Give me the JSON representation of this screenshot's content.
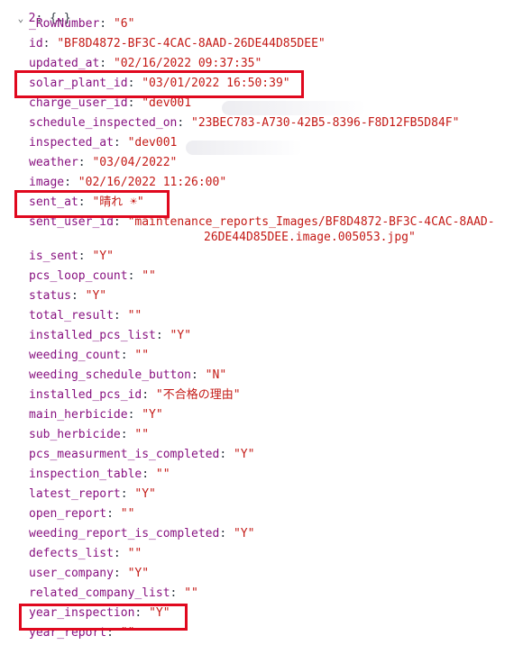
{
  "header": {
    "chevron": "⌄",
    "index": "2",
    "summary": "{…}"
  },
  "properties": [
    {
      "key": "_RowNumber",
      "value": "\"6\""
    },
    {
      "key": "id",
      "value": "\"BF8D4872-BF3C-4CAC-8AAD-26DE44D85DEE\""
    },
    {
      "key": "updated_at",
      "value": "\"02/16/2022 09:37:35\""
    },
    {
      "key": "solar_plant_id",
      "value": "\"03/01/2022 16:50:39\""
    },
    {
      "key": "charge_user_id",
      "value": "\"dev001"
    },
    {
      "key": "schedule_inspected_on",
      "value": "\"23BEC783-A730-42B5-8396-F8D12FB5D84F\""
    },
    {
      "key": "inspected_at",
      "value": "\"dev001"
    },
    {
      "key": "weather",
      "value": "\"03/04/2022\""
    },
    {
      "key": "image",
      "value": "\"02/16/2022 11:26:00\""
    },
    {
      "key": "sent_at",
      "value": "\"晴れ ☀\""
    },
    {
      "key": "sent_user_id",
      "value": "\"maintenance_reports_Images/BF8D4872-BF3C-4CAC-8AAD-",
      "continuation": "26DE44D85DEE.image.005053.jpg\""
    },
    {
      "key": "is_sent",
      "value": "\"Y\""
    },
    {
      "key": "pcs_loop_count",
      "value": "\"\""
    },
    {
      "key": "status",
      "value": "\"Y\""
    },
    {
      "key": "total_result",
      "value": "\"\""
    },
    {
      "key": "installed_pcs_list",
      "value": "\"Y\""
    },
    {
      "key": "weeding_count",
      "value": "\"\""
    },
    {
      "key": "weeding_schedule_button",
      "value": "\"N\""
    },
    {
      "key": "installed_pcs_id",
      "value": "\"不合格の理由\""
    },
    {
      "key": "main_herbicide",
      "value": "\"Y\""
    },
    {
      "key": "sub_herbicide",
      "value": "\"\""
    },
    {
      "key": "pcs_measurment_is_completed",
      "value": "\"Y\""
    },
    {
      "key": "inspection_table",
      "value": "\"\""
    },
    {
      "key": "latest_report",
      "value": "\"Y\""
    },
    {
      "key": "open_report",
      "value": "\"\""
    },
    {
      "key": "weeding_report_is_completed",
      "value": "\"Y\""
    },
    {
      "key": "defects_list",
      "value": "\"\""
    },
    {
      "key": "user_company",
      "value": "\"Y\""
    },
    {
      "key": "related_company_list",
      "value": "\"\""
    },
    {
      "key": "year_inspection",
      "value": "\"Y\""
    },
    {
      "key": "year_report",
      "value": "\"\""
    }
  ],
  "highlight_color": "#e0081e",
  "colors": {
    "key": "#881280",
    "string": "#c41a16",
    "punct": "#303942"
  }
}
